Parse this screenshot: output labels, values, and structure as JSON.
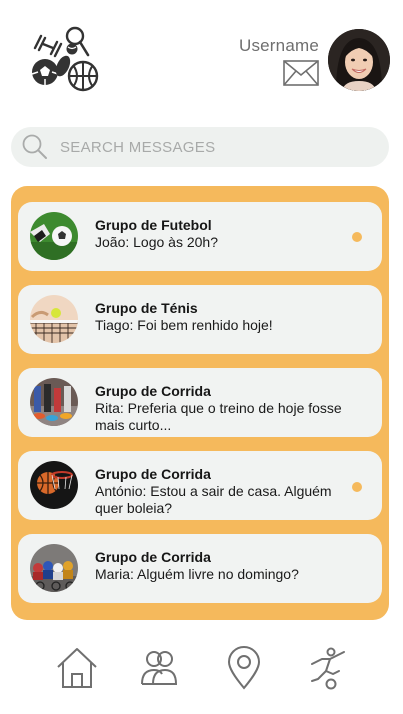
{
  "header": {
    "username": "Username"
  },
  "search": {
    "placeholder": "SEARCH MESSAGES"
  },
  "messages": [
    {
      "group": "Grupo de Futebol",
      "preview": "João: Logo às 20h?",
      "unread": true
    },
    {
      "group": "Grupo de Ténis",
      "preview": "Tiago: Foi bem renhido hoje!",
      "unread": false
    },
    {
      "group": "Grupo de Corrida",
      "preview": "Rita: Preferia que o treino de hoje fosse mais curto...",
      "unread": false
    },
    {
      "group": "Grupo de Corrida",
      "preview": "António: Estou a sair de casa. Alguém quer boleia?",
      "unread": true
    },
    {
      "group": "Grupo de Corrida",
      "preview": "Maria: Alguém livre no domingo?",
      "unread": false
    }
  ],
  "nav": [
    "home-icon",
    "friends-icon",
    "location-pin-icon",
    "sports-icon"
  ],
  "colors": {
    "accent": "#f5b95c",
    "card": "#f1f3f2",
    "search_bg": "#eef1ef",
    "icon_gray": "#6f6f6f"
  }
}
